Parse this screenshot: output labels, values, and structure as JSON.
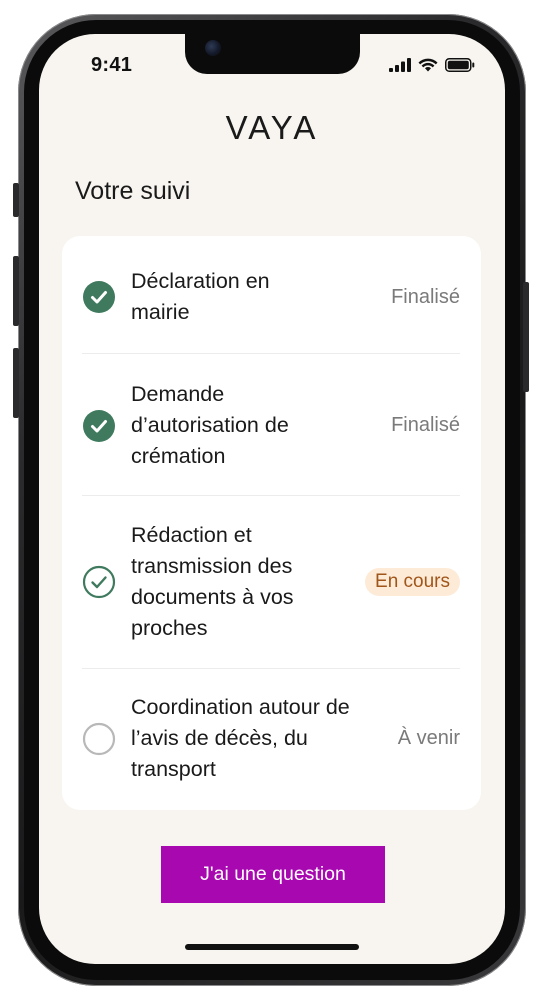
{
  "status_bar": {
    "time": "9:41"
  },
  "brand": "VAYA",
  "section_title": "Votre suivi",
  "steps": [
    {
      "label": "Déclaration en mairie",
      "status": "Finalisé",
      "state": "done"
    },
    {
      "label": "Demande d’autorisation de crémation",
      "status": "Finalisé",
      "state": "done"
    },
    {
      "label": "Rédaction et transmission des documents à vos proches",
      "status": "En cours",
      "state": "in-progress"
    },
    {
      "label": "Coordination autour de l’avis de décès, du transport",
      "status": "À venir",
      "state": "upcoming"
    }
  ],
  "cta_label": "J'ai une question",
  "colors": {
    "done": "#3f7a5e",
    "accent": "#a808b0",
    "in_progress_text": "#a0561a",
    "in_progress_bg": "#fdebd8",
    "background": "#f8f5f0"
  }
}
